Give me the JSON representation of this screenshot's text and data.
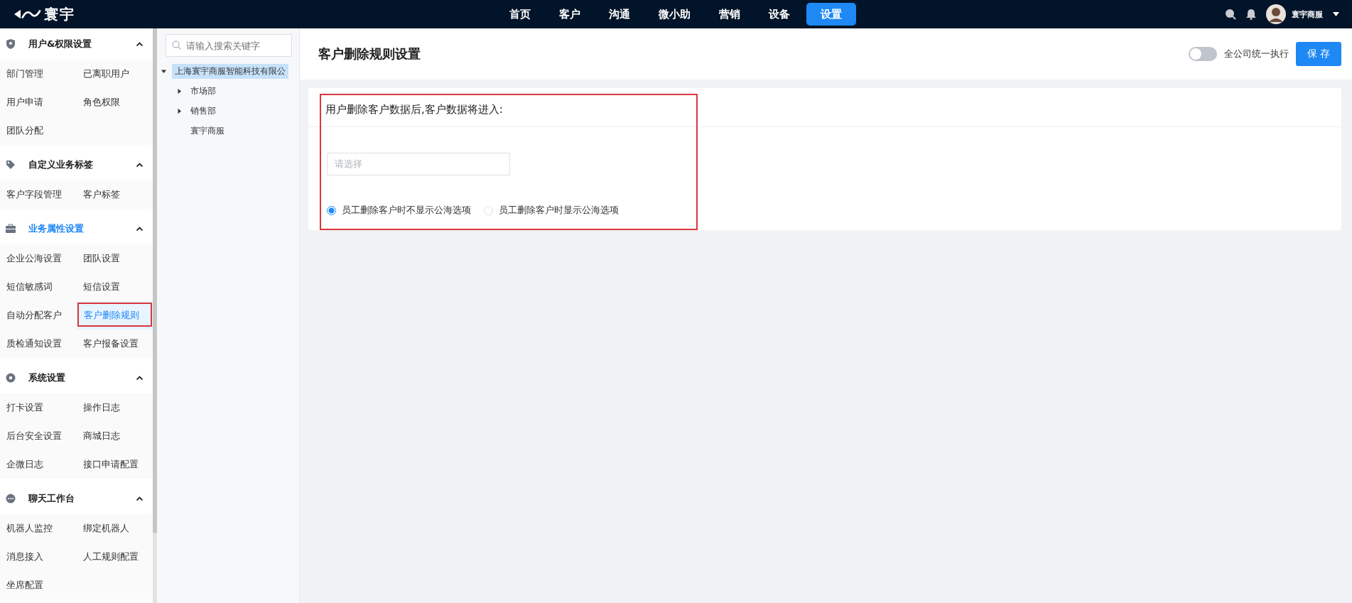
{
  "top_bar": {
    "logo_text": "寰宇",
    "nav": [
      {
        "label": "首页",
        "selected": false
      },
      {
        "label": "客户",
        "selected": false
      },
      {
        "label": "沟通",
        "selected": false
      },
      {
        "label": "微小助",
        "selected": false
      },
      {
        "label": "营销",
        "selected": false
      },
      {
        "label": "设备",
        "selected": false
      },
      {
        "label": "设置",
        "selected": true
      }
    ],
    "user_name": "寰宇商服"
  },
  "sidebar": {
    "groups": [
      {
        "title": "用户&权限设置",
        "active": false,
        "expanded": true,
        "items": [
          {
            "label": "部门管理",
            "selected": false
          },
          {
            "label": "已离职用户",
            "selected": false
          },
          {
            "label": "用户申请",
            "selected": false
          },
          {
            "label": "角色权限",
            "selected": false
          },
          {
            "label": "团队分配",
            "selected": false
          }
        ]
      },
      {
        "title": "自定义业务标签",
        "active": false,
        "expanded": true,
        "items": [
          {
            "label": "客户字段管理",
            "selected": false
          },
          {
            "label": "客户标签",
            "selected": false
          }
        ]
      },
      {
        "title": "业务属性设置",
        "active": true,
        "expanded": true,
        "items": [
          {
            "label": "企业公海设置",
            "selected": false
          },
          {
            "label": "团队设置",
            "selected": false
          },
          {
            "label": "短信敏感词",
            "selected": false
          },
          {
            "label": "短信设置",
            "selected": false
          },
          {
            "label": "自动分配客户",
            "selected": false
          },
          {
            "label": "客户删除规则",
            "selected": true
          },
          {
            "label": "质检通知设置",
            "selected": false
          },
          {
            "label": "客户报备设置",
            "selected": false
          }
        ]
      },
      {
        "title": "系统设置",
        "active": false,
        "expanded": true,
        "items": [
          {
            "label": "打卡设置",
            "selected": false
          },
          {
            "label": "操作日志",
            "selected": false
          },
          {
            "label": "后台安全设置",
            "selected": false
          },
          {
            "label": "商城日志",
            "selected": false
          },
          {
            "label": "企微日志",
            "selected": false
          },
          {
            "label": "接口申请配置",
            "selected": false
          }
        ]
      },
      {
        "title": "聊天工作台",
        "active": false,
        "expanded": true,
        "items": [
          {
            "label": "机器人监控",
            "selected": false
          },
          {
            "label": "绑定机器人",
            "selected": false
          },
          {
            "label": "消息接入",
            "selected": false
          },
          {
            "label": "人工规则配置",
            "selected": false
          },
          {
            "label": "坐席配置",
            "selected": false
          }
        ]
      }
    ]
  },
  "tree": {
    "search_placeholder": "请输入搜索关键字",
    "nodes": [
      {
        "label": "上海寰宇商服智能科技有限公",
        "selected": true,
        "expanded": true,
        "children": [
          {
            "label": "市场部",
            "selected": false,
            "expanded": false
          },
          {
            "label": "销售部",
            "selected": false,
            "expanded": false
          },
          {
            "label": "寰宇商服",
            "selected": false
          }
        ]
      }
    ]
  },
  "page": {
    "title": "客户删除规则设置",
    "toggle": {
      "label": "全公司统一执行",
      "on": false
    },
    "save_button": "保 存",
    "card": {
      "prompt": "用户删除客户数据后,客户数据将进入:",
      "select": {
        "placeholder": "请选择"
      },
      "radios": [
        {
          "label": "员工删除客户时不显示公海选项",
          "selected": true
        },
        {
          "label": "员工删除客户时显示公海选项",
          "selected": false
        }
      ]
    }
  }
}
